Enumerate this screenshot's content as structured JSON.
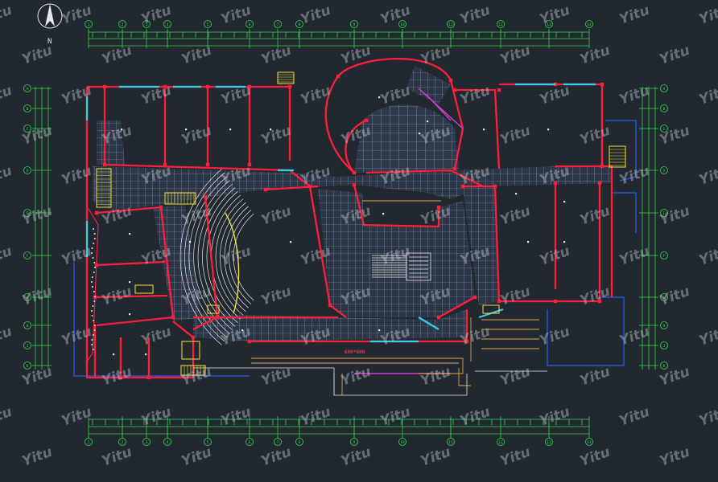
{
  "north_arrow": {
    "label": "N"
  },
  "watermark": {
    "text": "Yitu"
  },
  "grid_axes_top": [
    "1",
    "2",
    "3",
    "4",
    "5",
    "6",
    "7",
    "8",
    "9",
    "10",
    "11",
    "12",
    "13",
    "14"
  ],
  "grid_axes_side": [
    "A",
    "B",
    "C",
    "D",
    "E",
    "F",
    "G",
    "H",
    "J",
    "K"
  ],
  "floor_tile_note": "600*600",
  "drawing_title": "",
  "right_note": "",
  "colors": {
    "background": "#212830",
    "wall": "#ff1e3c",
    "tile_grid": "#8fa0bc",
    "dimension": "#35d44a",
    "window": "#2fd0e8",
    "stair": "#f2e23a",
    "blue_outline": "#2e57e8",
    "annotation": "#e8e8e8",
    "magenta": "#d23cd2",
    "orange": "#e0a24a"
  }
}
